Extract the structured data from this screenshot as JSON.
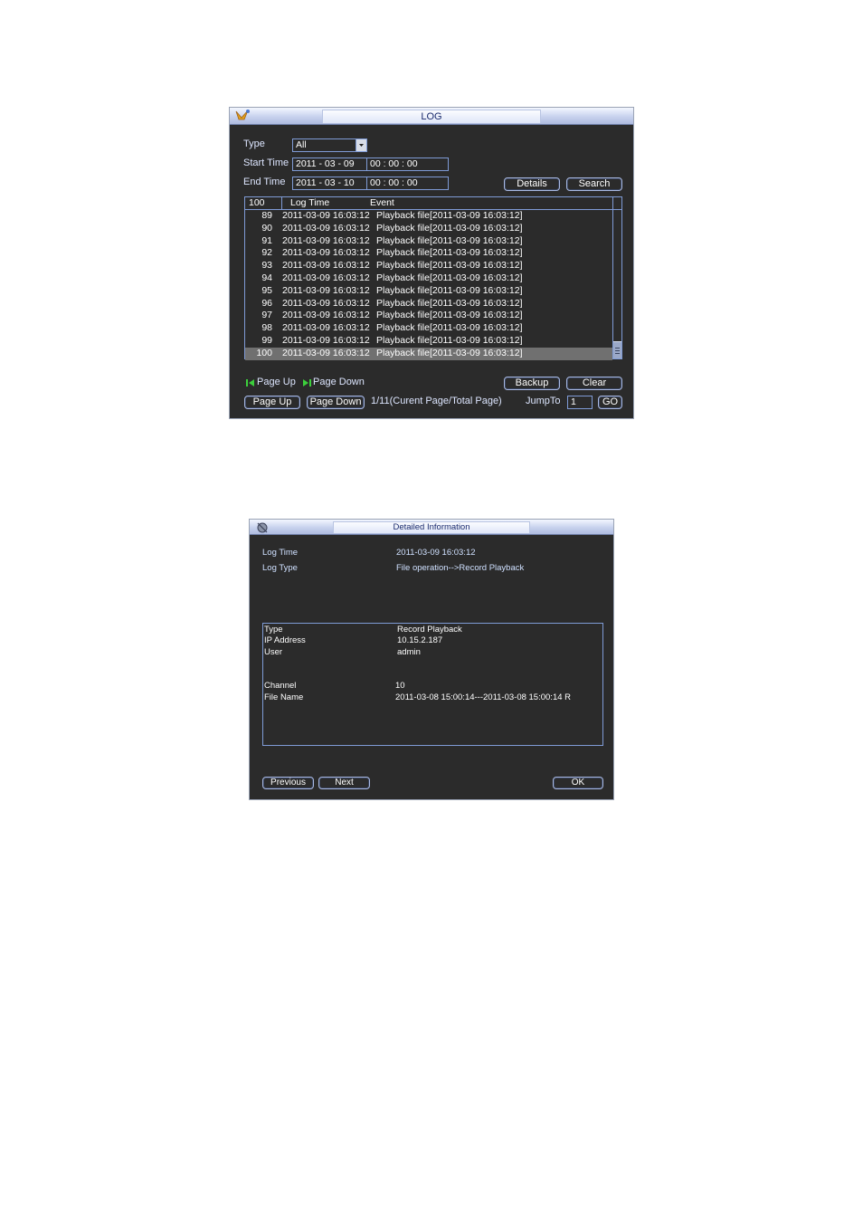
{
  "log_window": {
    "title": "LOG",
    "type_label": "Type",
    "type_value": "All",
    "start_label": "Start Time",
    "start_date": "2011  - 03 - 09",
    "start_time": "00 :  00 :  00",
    "end_label": "End Time",
    "end_date": "2011  - 03 - 10",
    "end_time": "00 :  00 :  00",
    "details_button": "Details",
    "search_button": "Search",
    "header_count": "100",
    "header_log_time": "Log Time",
    "header_event": "Event",
    "rows": [
      {
        "num": "89",
        "time": "2011-03-09 16:03:12",
        "event": "Playback file[2011-03-09 16:03:12]"
      },
      {
        "num": "90",
        "time": "2011-03-09 16:03:12",
        "event": "Playback file[2011-03-09 16:03:12]"
      },
      {
        "num": "91",
        "time": "2011-03-09 16:03:12",
        "event": "Playback file[2011-03-09 16:03:12]"
      },
      {
        "num": "92",
        "time": "2011-03-09 16:03:12",
        "event": "Playback file[2011-03-09 16:03:12]"
      },
      {
        "num": "93",
        "time": "2011-03-09 16:03:12",
        "event": "Playback file[2011-03-09 16:03:12]"
      },
      {
        "num": "94",
        "time": "2011-03-09 16:03:12",
        "event": "Playback file[2011-03-09 16:03:12]"
      },
      {
        "num": "95",
        "time": "2011-03-09 16:03:12",
        "event": "Playback file[2011-03-09 16:03:12]"
      },
      {
        "num": "96",
        "time": "2011-03-09 16:03:12",
        "event": "Playback file[2011-03-09 16:03:12]"
      },
      {
        "num": "97",
        "time": "2011-03-09 16:03:12",
        "event": "Playback file[2011-03-09 16:03:12]"
      },
      {
        "num": "98",
        "time": "2011-03-09 16:03:12",
        "event": "Playback file[2011-03-09 16:03:12]"
      },
      {
        "num": "99",
        "time": "2011-03-09 16:03:12",
        "event": "Playback file[2011-03-09 16:03:12]"
      },
      {
        "num": "100",
        "time": "2011-03-09 16:03:12",
        "event": "Playback file[2011-03-09 16:03:12]",
        "selected": true
      }
    ],
    "hint_page_up": "Page Up",
    "hint_page_down": "Page Down",
    "backup_button": "Backup",
    "clear_button": "Clear",
    "page_up_button": "Page Up",
    "page_down_button": "Page Down",
    "page_info": "1/11(Curent Page/Total Page)",
    "jump_label": "JumpTo",
    "jump_value": "1",
    "go_button": "GO",
    "colors": {
      "accent": "#7f9bd6",
      "background": "#2b2b2b",
      "hint_icon": "#3ccf3c",
      "selected_row": "#707070"
    }
  },
  "detail_window": {
    "title": "Detailed Information",
    "log_time_label": "Log Time",
    "log_time_value": "2011-03-09 16:03:12",
    "log_type_label": "Log Type",
    "log_type_value": "File operation-->Record Playback",
    "type_label": "Type",
    "type_value": "Record Playback",
    "ip_label": "IP Address",
    "ip_value": "10.15.2.187",
    "user_label": "User",
    "user_value": "admin",
    "channel_label": "Channel",
    "channel_value": "10",
    "file_label": "File Name",
    "file_value": "2011-03-08 15:00:14---2011-03-08 15:00:14 R",
    "previous_button": "Previous",
    "next_button": "Next",
    "ok_button": "OK"
  }
}
